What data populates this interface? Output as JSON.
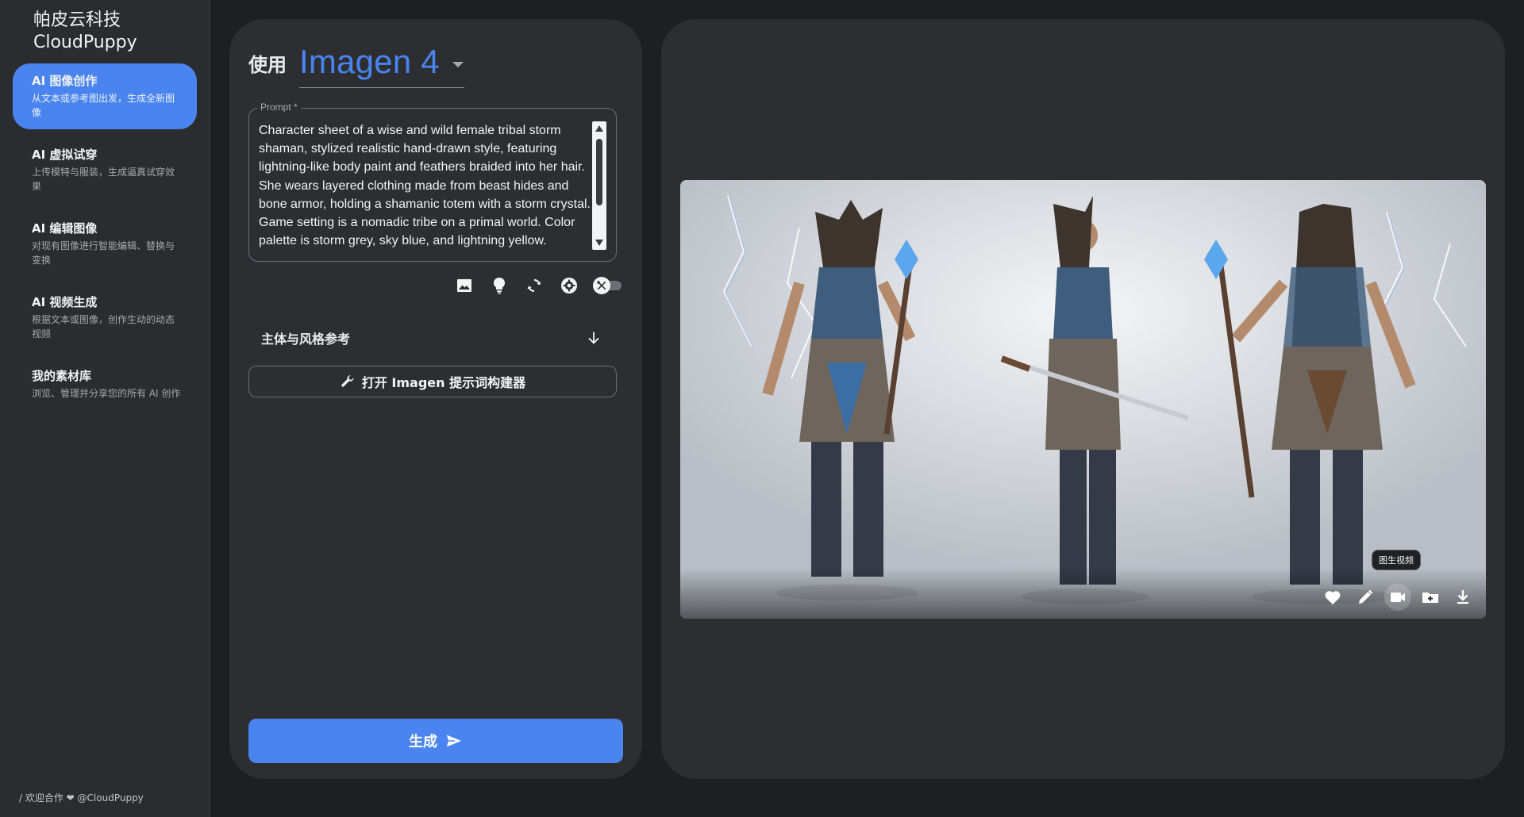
{
  "brand": {
    "line1": "帕皮云科技",
    "line2": "CloudPuppy"
  },
  "sidebar": {
    "items": [
      {
        "title": "AI 图像创作",
        "desc": "从文本或参考图出发，生成全新图像",
        "active": true
      },
      {
        "title": "AI 虚拟试穿",
        "desc": "上传模特与服装，生成逼真试穿效果",
        "active": false
      },
      {
        "title": "AI 编辑图像",
        "desc": "对现有图像进行智能编辑、替换与变换",
        "active": false
      },
      {
        "title": "AI 视频生成",
        "desc": "根据文本或图像，创作生动的动态视频",
        "active": false
      },
      {
        "title": "我的素材库",
        "desc": "浏览、管理并分享您的所有 AI 创作",
        "active": false
      }
    ],
    "footer": "/ 欢迎合作 ❤ @CloudPuppy"
  },
  "model": {
    "label": "使用",
    "value": "Imagen 4"
  },
  "prompt": {
    "label": "Prompt *",
    "text": "Character sheet of a wise and wild female tribal storm shaman, stylized realistic hand-drawn style, featuring lightning-like body paint and feathers braided into her hair. She wears layered clothing made from beast hides and bone armor, holding a shamanic totem with a storm crystal. Game setting is a nomadic tribe on a primal world. Color palette is storm grey, sky blue, and lightning yellow."
  },
  "tools": [
    "image-icon",
    "lightbulb-icon",
    "refresh-icon",
    "settings-icon",
    "tools-toggle"
  ],
  "reference": {
    "label": "主体与风格参考"
  },
  "builder": {
    "label": "打开 Imagen 提示词构建器"
  },
  "generate": {
    "label": "生成"
  },
  "result": {
    "tooltip": "图生视频",
    "actions": [
      "heart-icon",
      "edit-icon",
      "video-icon",
      "add-folder-icon",
      "download-icon"
    ]
  },
  "colors": {
    "accent": "#4a84ee",
    "background": "#1e1f22",
    "panel": "#2d2e32"
  }
}
